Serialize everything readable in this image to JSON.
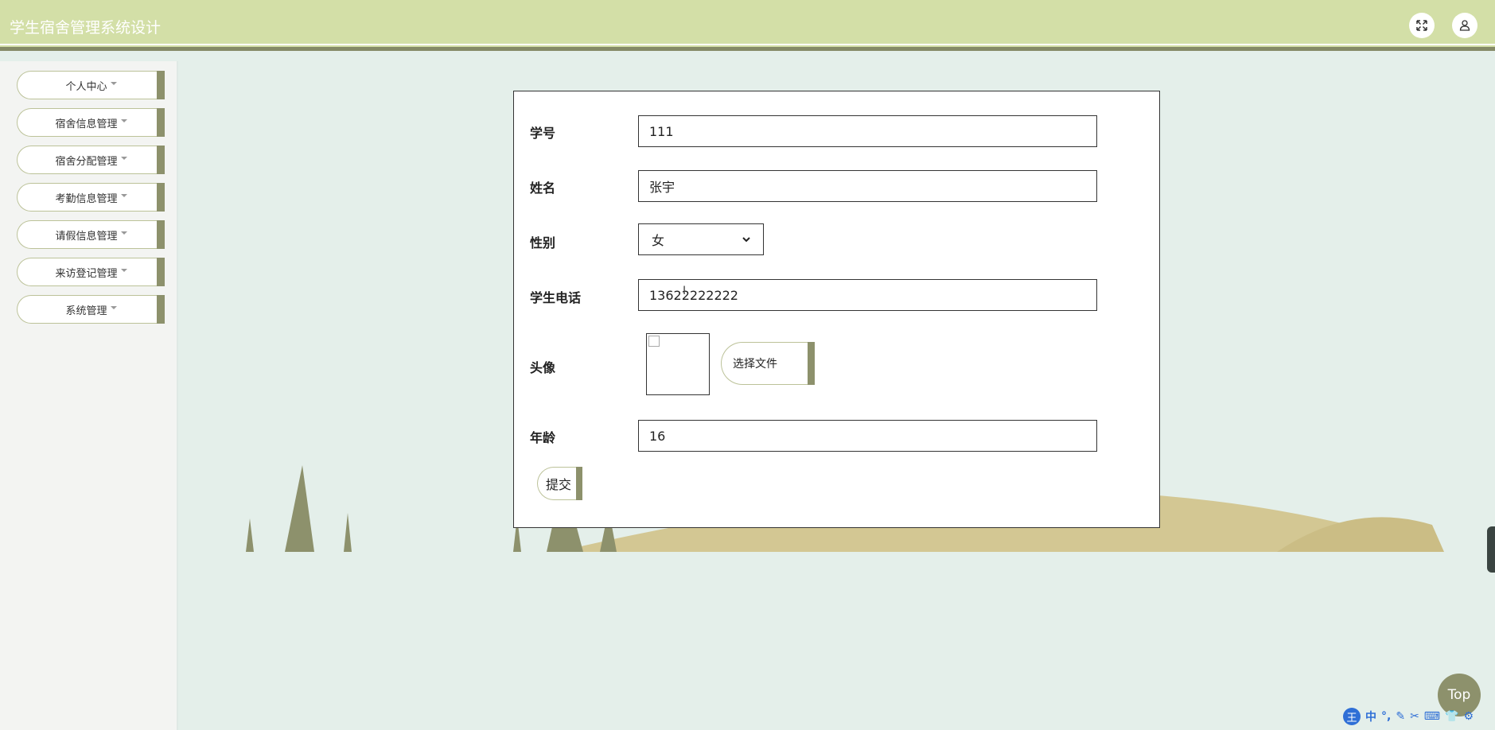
{
  "header": {
    "title": "学生宿舍管理系统设计"
  },
  "sidebar": {
    "items": [
      {
        "label": "个人中心"
      },
      {
        "label": "宿舍信息管理"
      },
      {
        "label": "宿舍分配管理"
      },
      {
        "label": "考勤信息管理"
      },
      {
        "label": "请假信息管理"
      },
      {
        "label": "来访登记管理"
      },
      {
        "label": "系统管理"
      }
    ]
  },
  "form": {
    "student_id": {
      "label": "学号",
      "value": "111"
    },
    "name": {
      "label": "姓名",
      "value": "张宇"
    },
    "gender": {
      "label": "性别",
      "value": "女"
    },
    "phone": {
      "label": "学生电话",
      "value": "13622222222"
    },
    "avatar": {
      "label": "头像",
      "choose_label": "选择文件"
    },
    "age": {
      "label": "年龄",
      "value": "16"
    },
    "submit_label": "提交"
  },
  "top_button": {
    "label": "Top"
  },
  "ime": {
    "logo": "王",
    "mode": "中"
  },
  "colors": {
    "header_bg": "#d3dfa7",
    "accent": "#8d916c",
    "page_bg": "#e4efea",
    "sand": "#d3c793"
  }
}
